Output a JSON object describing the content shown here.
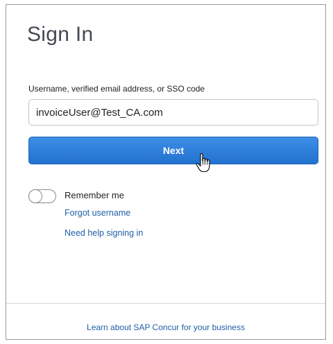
{
  "signin": {
    "title": "Sign In",
    "username_label": "Username, verified email address, or SSO code",
    "username_value": "invoiceUser@Test_CA.com",
    "next_label": "Next",
    "remember_label": "Remember me",
    "remember_checked": false,
    "forgot_username": "Forgot username",
    "need_help": "Need help signing in"
  },
  "footer": {
    "learn_link": "Learn about SAP Concur for your business"
  },
  "colors": {
    "primary_button": "#2a7bd6",
    "link": "#1f5fa8",
    "title": "#444a52"
  },
  "icons": {
    "cursor": "hand-pointer-icon"
  }
}
